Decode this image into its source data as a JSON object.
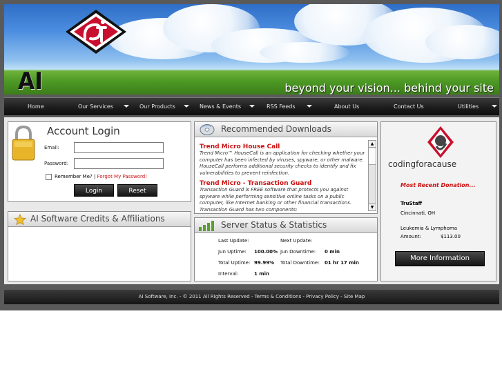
{
  "header": {
    "brand": "AI SOFTWARE",
    "tagline": "beyond your vision... behind your site"
  },
  "nav": {
    "items": [
      {
        "label": "Home"
      },
      {
        "label": "Our Services"
      },
      {
        "label": "Our Products"
      },
      {
        "label": "News & Events"
      },
      {
        "label": "RSS Feeds"
      },
      {
        "label": "About Us"
      },
      {
        "label": "Contact Us"
      },
      {
        "label": "Utilities"
      }
    ]
  },
  "login": {
    "title": "Account Login",
    "email_label": "Email:",
    "email_value": "",
    "password_label": "Password:",
    "password_value": "",
    "remember_label": "Remember Me?",
    "separator": "|",
    "forgot_label": "Forgot My Password!",
    "login_button": "Login",
    "reset_button": "Reset"
  },
  "credits": {
    "title": "AI Software Credits & Affiliations"
  },
  "downloads": {
    "title": "Recommended Downloads",
    "items": [
      {
        "title": "Trend Micro House Call",
        "desc": "Trend Micro™ HouseCall is an application for checking whether your computer has been infected by viruses, spyware, or other malware. HouseCall performs additional security checks to identify and fix vulnerabilities to prevent reinfection."
      },
      {
        "title": "Trend Micro - Transaction Guard",
        "desc": "Transaction Guard is FREE software that protects you against spyware while performing sensitive online tasks on a public computer, like Internet banking or other financial transactions. Transaction Guard has two components:"
      }
    ]
  },
  "server": {
    "title": "Server Status & Statistics",
    "last_update_label": "Last Update:",
    "last_update_value": "",
    "next_update_label": "Next Update:",
    "next_update_value": "",
    "month_uptime_label": "Jun Uptime:",
    "month_uptime_value": "100.00%",
    "month_downtime_label": "Jun Downtime:",
    "month_downtime_value": "0 min",
    "total_uptime_label": "Total Uptime:",
    "total_uptime_value": "99.99%",
    "total_downtime_label": "Total Downtime:",
    "total_downtime_value": "01 hr 17 min",
    "interval_label": "Interval:",
    "interval_value": "1 min"
  },
  "cause": {
    "logo_text": "codingforacause",
    "recent_title": "Most Recent Donation...",
    "org_name": "TruStaff",
    "location": "Cincinnati, OH",
    "cause_name": "Leukemia & Lymphoma",
    "amount_label": "Amount:",
    "amount_value": "$113.00",
    "more_button": "More Information"
  },
  "footer": {
    "text": "AI Software, Inc. - © 2011 All Rights Reserved - Terms & Conditions - Privacy Policy - Site Map"
  },
  "colors": {
    "accent_red": "#cc1111",
    "nav_dark": "#1d1d1d",
    "frame_gray": "#5a5a5a"
  }
}
